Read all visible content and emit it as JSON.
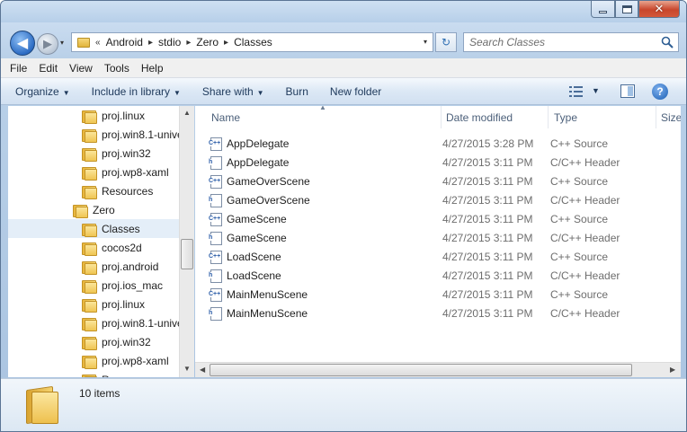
{
  "window": {
    "buttons": {
      "minimize": "minimize",
      "maximize": "maximize",
      "close": "✕"
    }
  },
  "nav": {
    "recent_pages_label": "▾",
    "breadcrumb_prefix": "«",
    "breadcrumb": [
      "Android",
      "stdio",
      "Zero",
      "Classes"
    ],
    "separator": "▸",
    "dropdown_glyph": "▾",
    "refresh_glyph": "↻",
    "search_placeholder": "Search Classes"
  },
  "menubar": [
    "File",
    "Edit",
    "View",
    "Tools",
    "Help"
  ],
  "commandbar": {
    "organize": "Organize",
    "include_in_library": "Include in library",
    "share_with": "Share with",
    "burn": "Burn",
    "new_folder": "New folder",
    "help_glyph": "?"
  },
  "navpane": {
    "items": [
      {
        "label": "proj.linux",
        "level": 1
      },
      {
        "label": "proj.win8.1-unive",
        "level": 1
      },
      {
        "label": "proj.win32",
        "level": 1
      },
      {
        "label": "proj.wp8-xaml",
        "level": 1
      },
      {
        "label": "Resources",
        "level": 1
      },
      {
        "label": "Zero",
        "level": 0
      },
      {
        "label": "Classes",
        "level": 1,
        "selected": true
      },
      {
        "label": "cocos2d",
        "level": 1
      },
      {
        "label": "proj.android",
        "level": 1
      },
      {
        "label": "proj.ios_mac",
        "level": 1
      },
      {
        "label": "proj.linux",
        "level": 1
      },
      {
        "label": "proj.win8.1-unive",
        "level": 1
      },
      {
        "label": "proj.win32",
        "level": 1
      },
      {
        "label": "proj.wp8-xaml",
        "level": 1
      },
      {
        "label": "R",
        "level": 1
      }
    ]
  },
  "content": {
    "columns": {
      "name": "Name",
      "date": "Date modified",
      "type": "Type",
      "size": "Size"
    },
    "files": [
      {
        "name": "AppDelegate",
        "date": "4/27/2015 3:28 PM",
        "type": "C++ Source",
        "icon": "cpp-source-icon"
      },
      {
        "name": "AppDelegate",
        "date": "4/27/2015 3:11 PM",
        "type": "C/C++ Header",
        "icon": "header-file-icon"
      },
      {
        "name": "GameOverScene",
        "date": "4/27/2015 3:11 PM",
        "type": "C++ Source",
        "icon": "cpp-source-icon"
      },
      {
        "name": "GameOverScene",
        "date": "4/27/2015 3:11 PM",
        "type": "C/C++ Header",
        "icon": "header-file-icon"
      },
      {
        "name": "GameScene",
        "date": "4/27/2015 3:11 PM",
        "type": "C++ Source",
        "icon": "cpp-source-icon"
      },
      {
        "name": "GameScene",
        "date": "4/27/2015 3:11 PM",
        "type": "C/C++ Header",
        "icon": "header-file-icon"
      },
      {
        "name": "LoadScene",
        "date": "4/27/2015 3:11 PM",
        "type": "C++ Source",
        "icon": "cpp-source-icon"
      },
      {
        "name": "LoadScene",
        "date": "4/27/2015 3:11 PM",
        "type": "C/C++ Header",
        "icon": "header-file-icon"
      },
      {
        "name": "MainMenuScene",
        "date": "4/27/2015 3:11 PM",
        "type": "C++ Source",
        "icon": "cpp-source-icon"
      },
      {
        "name": "MainMenuScene",
        "date": "4/27/2015 3:11 PM",
        "type": "C/C++ Header",
        "icon": "header-file-icon"
      }
    ]
  },
  "details": {
    "item_count": "10 items"
  },
  "colors": {
    "accent": "#1e395b",
    "selection": "#e4eef8",
    "muted_text": "#6d6d6d"
  }
}
